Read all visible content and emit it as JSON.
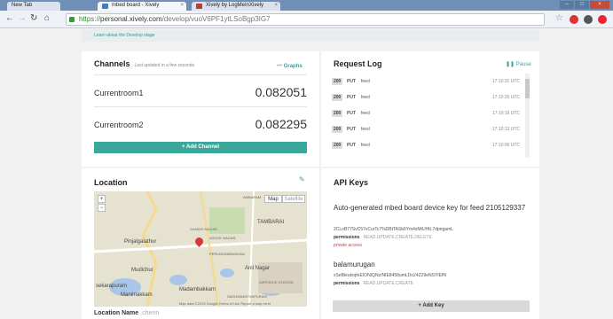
{
  "browser": {
    "tabs": [
      {
        "title": "New Tab",
        "active": false
      },
      {
        "title": "mbed board - Xively",
        "active": true
      },
      {
        "title": "Xively by LogMeInXively",
        "active": false
      }
    ],
    "url_scheme": "https://",
    "url_host": "personal.xively.com",
    "url_path": "/develop/vuoV6PF1ytLSoBgp3IG7"
  },
  "banner": {
    "text": "Learn about the Develop stage"
  },
  "channels": {
    "title": "Channels",
    "updated": "Last updated in a few seconds",
    "graphs_label": "Graphs",
    "items": [
      {
        "name": "Currentroom1",
        "value": "0.082051"
      },
      {
        "name": "Currentroom2",
        "value": "0.082295"
      }
    ],
    "add_label": "Add Channel"
  },
  "request_log": {
    "title": "Request Log",
    "pause_label": "Pause",
    "rows": [
      {
        "code": "200",
        "method": "PUT",
        "path": "feed",
        "time": "17:10:31 UTC"
      },
      {
        "code": "200",
        "method": "PUT",
        "path": "feed",
        "time": "17:10:25 UTC"
      },
      {
        "code": "200",
        "method": "PUT",
        "path": "feed",
        "time": "17:10:19 UTC"
      },
      {
        "code": "200",
        "method": "PUT",
        "path": "feed",
        "time": "17:10:13 UTC"
      },
      {
        "code": "200",
        "method": "PUT",
        "path": "feed",
        "time": "17:10:06 UTC"
      }
    ]
  },
  "location": {
    "title": "Location",
    "map_type_map": "Map",
    "map_type_satellite": "Satellite",
    "zoom_in": "+",
    "zoom_out": "−",
    "labels": [
      "AMBARAM",
      "GANDHI NAGAR",
      "ASHOK NAGAR",
      "TAMBARAI",
      "Pinjalgalathur",
      "Mudichur",
      "PERUNGAMBAKKAM",
      "Anil Nagar",
      "Madambakkam",
      "Manimakkam",
      "sekarapuram",
      "AIRFORCE STATION",
      "SADHANANTHAPURAM"
    ],
    "attribution": "Map data ©2015 Google   Terms of Use   Report a map error",
    "name_label": "Location Name",
    "name_value": "chenn"
  },
  "api_keys": {
    "title": "API Keys",
    "description": "Auto-generated mbed board device key for feed 2105129337",
    "key1": "2CLoB77SvC57vCurTc7%DBtTASkIIYm4zMtUHtL7dpngamL",
    "perm1_label": "permissions",
    "perm1_value": "READ,UPDATE,CREATE,DELETE",
    "private": "private access",
    "name2": "balamurugan",
    "key2": "xSeBleutxqfeEIONIQNz/NIE8458umLDo24Z29eNSYIEfN",
    "perm2_label": "permissions",
    "perm2_value": "READ,UPDATE,CREATE",
    "add_label": "Add Key"
  },
  "colors": {
    "accent": "#3aa99c",
    "tabbar": "#6f8fb7",
    "pin": "#d43a3a"
  }
}
